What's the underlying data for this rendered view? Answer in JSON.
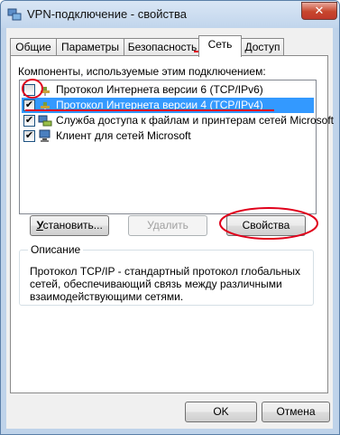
{
  "window": {
    "title": "VPN-подключение - свойства",
    "close_glyph": "✕"
  },
  "tabs": [
    {
      "label": "Общие"
    },
    {
      "label": "Параметры"
    },
    {
      "label": "Безопасность"
    },
    {
      "label": "Сеть",
      "active": true
    },
    {
      "label": "Доступ"
    }
  ],
  "components": {
    "label": "Компоненты, используемые этим подключением:",
    "items": [
      {
        "label": "Протокол Интернета версии 6 (TCP/IPv6)",
        "checked": false,
        "icon": "network-protocol-icon"
      },
      {
        "label": "Протокол Интернета версии 4 (TCP/IPv4)",
        "checked": true,
        "selected": true,
        "icon": "network-protocol-icon"
      },
      {
        "label": "Служба доступа к файлам и принтерам сетей Microsoft",
        "checked": true,
        "icon": "file-printer-sharing-icon"
      },
      {
        "label": "Клиент для сетей Microsoft",
        "checked": true,
        "icon": "network-client-icon"
      }
    ]
  },
  "buttons": {
    "install": "Установить...",
    "uninstall": "Удалить",
    "properties": "Свойства",
    "ok": "OK",
    "cancel": "Отмена"
  },
  "description": {
    "legend": "Описание",
    "text": "Протокол TCP/IP - стандартный протокол глобальных сетей, обеспечивающий связь между различными взаимодействующими сетями."
  },
  "colors": {
    "selection": "#3399ff",
    "annotation": "#e0001b"
  }
}
